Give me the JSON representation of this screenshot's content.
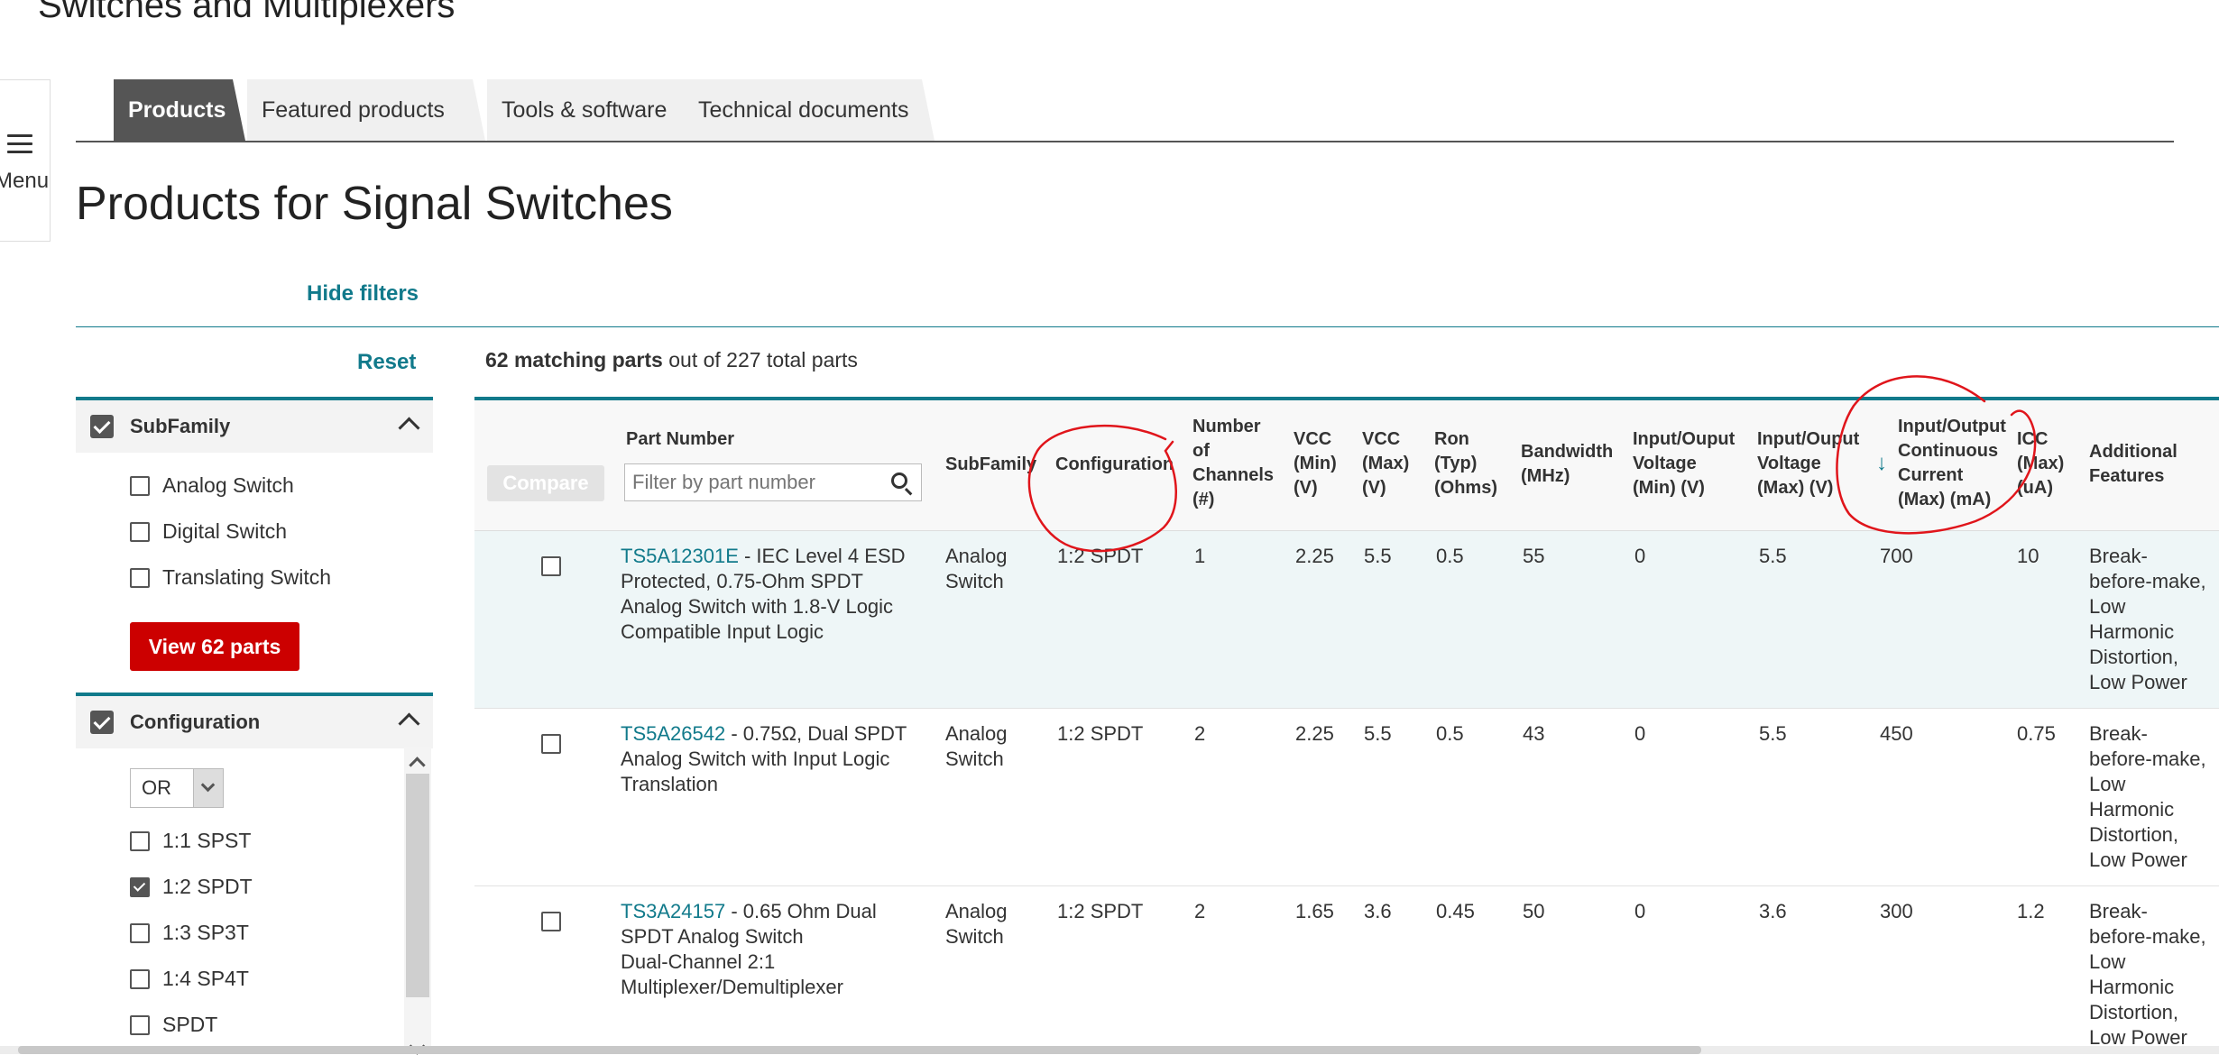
{
  "page": {
    "heading": "Switches and Multiplexers",
    "section_title": "Products for Signal Switches"
  },
  "menu": {
    "label": "Menu"
  },
  "tabs": [
    {
      "label": "Products",
      "active": true
    },
    {
      "label": "Featured products",
      "active": false
    },
    {
      "label": "Tools & software",
      "active": false
    },
    {
      "label": "Technical documents",
      "active": false
    }
  ],
  "filters": {
    "hide_label": "Hide filters",
    "reset_label": "Reset",
    "subfamily": {
      "title": "SubFamily",
      "options": [
        {
          "label": "Analog Switch",
          "checked": false
        },
        {
          "label": "Digital Switch",
          "checked": false
        },
        {
          "label": "Translating Switch",
          "checked": false
        }
      ],
      "view_button": "View 62 parts"
    },
    "configuration": {
      "title": "Configuration",
      "logic": "OR",
      "options": [
        {
          "label": "1:1 SPST",
          "checked": false
        },
        {
          "label": "1:2 SPDT",
          "checked": true
        },
        {
          "label": "1:3 SP3T",
          "checked": false
        },
        {
          "label": "1:4 SP4T",
          "checked": false
        },
        {
          "label": "SPDT",
          "checked": false
        }
      ]
    }
  },
  "results": {
    "matching": "62 matching parts",
    "rest": " out of 227 total parts"
  },
  "table": {
    "compare_label": "Compare",
    "part_filter_placeholder": "Filter by part number",
    "headers": {
      "part_number": "Part Number",
      "subfamily": "SubFamily",
      "configuration": "Configuration",
      "channels": [
        "Number",
        "of",
        "Channels",
        "(#)"
      ],
      "vcc_min": [
        "VCC",
        "(Min)",
        "(V)"
      ],
      "vcc_max": [
        "VCC",
        "(Max)",
        "(V)"
      ],
      "ron": [
        "Ron",
        "(Typ)",
        "(Ohms)"
      ],
      "bandwidth": [
        "Bandwidth",
        "(MHz)"
      ],
      "io_vmin": [
        "Input/Ouput",
        "Voltage",
        "(Min) (V)"
      ],
      "io_vmax": [
        "Input/Ouput",
        "Voltage",
        "(Max) (V)"
      ],
      "io_current": [
        "Input/Output",
        "Continuous",
        "Current",
        "(Max) (mA)"
      ],
      "icc": [
        "ICC",
        "(Max)",
        "(uA)"
      ],
      "features": [
        "Additional",
        "Features"
      ]
    },
    "rows": [
      {
        "part": "TS5A12301E",
        "desc_lines": [
          " - IEC Level 4 ESD",
          "Protected, 0.75-Ohm SPDT",
          "Analog Switch with 1.8-V Logic",
          "Compatible Input Logic"
        ],
        "subfamily": [
          "Analog",
          "Switch"
        ],
        "config": "1:2 SPDT",
        "channels": "1",
        "vcc_min": "2.25",
        "vcc_max": "5.5",
        "ron": "0.5",
        "bandwidth": "55",
        "io_vmin": "0",
        "io_vmax": "5.5",
        "io_current": "700",
        "icc": "10",
        "features": [
          "Break-",
          "before-make,",
          "Low",
          "Harmonic",
          "Distortion,",
          "Low Power"
        ]
      },
      {
        "part": "TS5A26542",
        "desc_lines": [
          " - 0.75Ω, Dual SPDT",
          "Analog Switch with Input Logic",
          "Translation"
        ],
        "subfamily": [
          "Analog",
          "Switch"
        ],
        "config": "1:2 SPDT",
        "channels": "2",
        "vcc_min": "2.25",
        "vcc_max": "5.5",
        "ron": "0.5",
        "bandwidth": "43",
        "io_vmin": "0",
        "io_vmax": "5.5",
        "io_current": "450",
        "icc": "0.75",
        "features": [
          "Break-",
          "before-make,",
          "Low",
          "Harmonic",
          "Distortion,",
          "Low Power"
        ]
      },
      {
        "part": "TS3A24157",
        "desc_lines": [
          " - 0.65 Ohm Dual",
          "SPDT Analog Switch",
          "Dual-Channel 2:1",
          "Multiplexer/Demultiplexer"
        ],
        "subfamily": [
          "Analog",
          "Switch"
        ],
        "config": "1:2 SPDT",
        "channels": "2",
        "vcc_min": "1.65",
        "vcc_max": "3.6",
        "ron": "0.45",
        "bandwidth": "50",
        "io_vmin": "0",
        "io_vmax": "3.6",
        "io_current": "300",
        "icc": "1.2",
        "features": [
          "Break-",
          "before-make,",
          "Low",
          "Harmonic",
          "Distortion,",
          "Low Power"
        ]
      }
    ]
  },
  "annotation_color": "#e0151b",
  "accent_color": "#117a8b"
}
